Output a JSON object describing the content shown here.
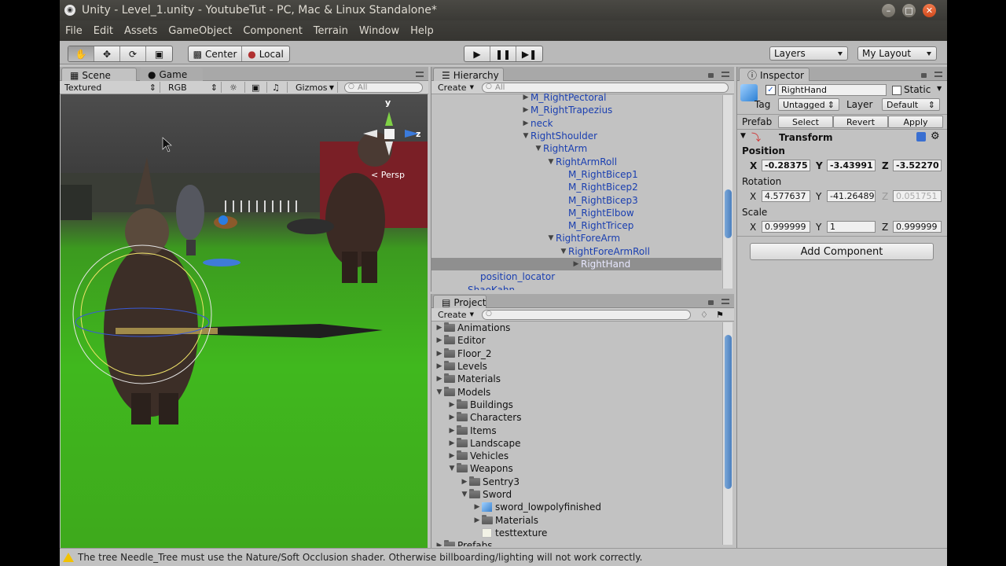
{
  "window": {
    "title": "Unity - Level_1.unity - YoutubeTut - PC, Mac & Linux Standalone*"
  },
  "menu": [
    "File",
    "Edit",
    "Assets",
    "GameObject",
    "Component",
    "Terrain",
    "Window",
    "Help"
  ],
  "toolbar": {
    "pivot_label": "Center",
    "space_label": "Local",
    "layers_label": "Layers",
    "layout_label": "My Layout"
  },
  "scene_panel": {
    "tab_scene": "Scene",
    "tab_game": "Game",
    "render_mode": "Textured",
    "color_mode": "RGB",
    "gizmos_label": "Gizmos",
    "search_placeholder": "All",
    "gizmo_y": "y",
    "gizmo_z": "z",
    "persp_label": "Persp"
  },
  "hierarchy": {
    "title": "Hierarchy",
    "create_label": "Create",
    "search_placeholder": "All",
    "items": [
      {
        "label": "M_RightPectoral",
        "depth": 0,
        "expander": "closed"
      },
      {
        "label": "M_RightTrapezius",
        "depth": 0,
        "expander": "closed"
      },
      {
        "label": "neck",
        "depth": 0,
        "expander": "closed"
      },
      {
        "label": "RightShoulder",
        "depth": 0,
        "expander": "open"
      },
      {
        "label": "RightArm",
        "depth": 1,
        "expander": "open"
      },
      {
        "label": "RightArmRoll",
        "depth": 2,
        "expander": "open"
      },
      {
        "label": "M_RightBicep1",
        "depth": 3,
        "expander": "none"
      },
      {
        "label": "M_RightBicep2",
        "depth": 3,
        "expander": "none"
      },
      {
        "label": "M_RightBicep3",
        "depth": 3,
        "expander": "none"
      },
      {
        "label": "M_RightElbow",
        "depth": 3,
        "expander": "none"
      },
      {
        "label": "M_RightTricep",
        "depth": 3,
        "expander": "none"
      },
      {
        "label": "RightForeArm",
        "depth": 2,
        "expander": "open"
      },
      {
        "label": "RightForeArmRoll",
        "depth": 3,
        "expander": "open"
      },
      {
        "label": "RightHand",
        "depth": 4,
        "expander": "closed",
        "selected": true
      },
      {
        "label": "position_locator",
        "depth": -4,
        "expander": "none"
      },
      {
        "label": "ShaoKahn",
        "depth": -5,
        "expander": "none"
      }
    ]
  },
  "project": {
    "title": "Project",
    "create_label": "Create",
    "items": [
      {
        "label": "Animations",
        "depth": 0,
        "expander": "closed"
      },
      {
        "label": "Editor",
        "depth": 0,
        "expander": "closed"
      },
      {
        "label": "Floor_2",
        "depth": 0,
        "expander": "closed"
      },
      {
        "label": "Levels",
        "depth": 0,
        "expander": "closed"
      },
      {
        "label": "Materials",
        "depth": 0,
        "expander": "closed"
      },
      {
        "label": "Models",
        "depth": 0,
        "expander": "open"
      },
      {
        "label": "Buildings",
        "depth": 1,
        "expander": "closed"
      },
      {
        "label": "Characters",
        "depth": 1,
        "expander": "closed"
      },
      {
        "label": "Items",
        "depth": 1,
        "expander": "closed"
      },
      {
        "label": "Landscape",
        "depth": 1,
        "expander": "closed"
      },
      {
        "label": "Vehicles",
        "depth": 1,
        "expander": "closed"
      },
      {
        "label": "Weapons",
        "depth": 1,
        "expander": "open"
      },
      {
        "label": "Sentry3",
        "depth": 2,
        "expander": "closed"
      },
      {
        "label": "Sword",
        "depth": 2,
        "expander": "open"
      },
      {
        "label": "sword_lowpolyfinished",
        "depth": 3,
        "expander": "closed",
        "icon": "model"
      },
      {
        "label": "Materials",
        "depth": 3,
        "expander": "closed"
      },
      {
        "label": "testtexture",
        "depth": 3,
        "expander": "none",
        "icon": "texture"
      },
      {
        "label": "Prefabs",
        "depth": 0,
        "expander": "closed"
      }
    ]
  },
  "inspector": {
    "title": "Inspector",
    "object_name": "RightHand",
    "static_label": "Static",
    "tag_label": "Tag",
    "tag_value": "Untagged",
    "layer_label": "Layer",
    "layer_value": "Default",
    "prefab_label": "Prefab",
    "select_label": "Select",
    "revert_label": "Revert",
    "apply_label": "Apply",
    "transform_label": "Transform",
    "position_label": "Position",
    "rotation_label": "Rotation",
    "scale_label": "Scale",
    "x": "X",
    "y": "Y",
    "z": "Z",
    "position": [
      "-0.28375",
      "-3.43991",
      "-3.52270"
    ],
    "rotation": [
      "4.577637",
      "-41.26489",
      "0.051751"
    ],
    "scale": [
      "0.999999",
      "1",
      "0.999999"
    ],
    "add_component_label": "Add Component"
  },
  "status": {
    "message": "The tree Needle_Tree must use the Nature/Soft Occlusion shader. Otherwise billboarding/lighting will not work correctly."
  }
}
